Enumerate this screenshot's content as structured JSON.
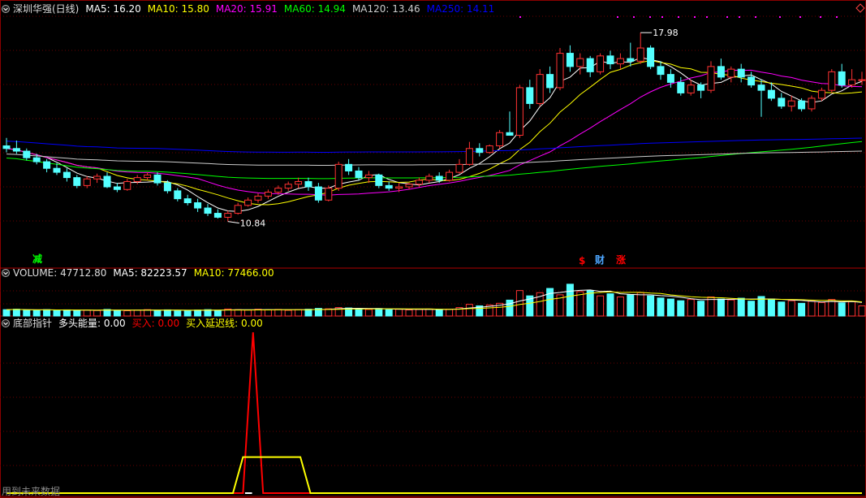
{
  "chart_data": {
    "type": "candlestick",
    "panels": [
      {
        "name": "price",
        "title": "深圳华强(日线)",
        "legend": [
          {
            "label": "MA5: 16.20",
            "color": "#ffffff"
          },
          {
            "label": "MA10: 15.80",
            "color": "#ffff00"
          },
          {
            "label": "MA20: 15.91",
            "color": "#ff00ff"
          },
          {
            "label": "MA60: 14.94",
            "color": "#00ff00"
          },
          {
            "label": "MA120: 13.46",
            "color": "#cccccc"
          },
          {
            "label": "MA250: 14.11",
            "color": "#0000ff"
          }
        ],
        "ylim": [
          10.0,
          18.6
        ],
        "annotations": [
          {
            "text": "17.98",
            "value": 17.98,
            "index": 63
          },
          {
            "text": "10.84",
            "value": 10.84,
            "index": 22
          }
        ],
        "markers": [
          {
            "text": "减",
            "color": "#00ff00"
          },
          {
            "text": "$",
            "color": "#ff0000"
          },
          {
            "text": "财",
            "color": "#4da6ff"
          },
          {
            "text": "涨",
            "color": "#ff0000"
          }
        ],
        "candles": [
          [
            13.7,
            14.0,
            13.45,
            13.6
          ],
          [
            13.6,
            13.9,
            13.4,
            13.5
          ],
          [
            13.5,
            13.6,
            13.15,
            13.25
          ],
          [
            13.25,
            13.4,
            13.0,
            13.1
          ],
          [
            13.1,
            13.2,
            12.7,
            12.85
          ],
          [
            12.85,
            13.05,
            12.6,
            12.7
          ],
          [
            12.7,
            12.85,
            12.35,
            12.5
          ],
          [
            12.5,
            12.6,
            12.1,
            12.2
          ],
          [
            12.2,
            12.55,
            12.1,
            12.45
          ],
          [
            12.45,
            12.65,
            12.3,
            12.55
          ],
          [
            12.55,
            12.7,
            12.1,
            12.15
          ],
          [
            12.15,
            12.3,
            11.95,
            12.05
          ],
          [
            12.05,
            12.45,
            12.0,
            12.35
          ],
          [
            12.35,
            12.6,
            12.25,
            12.5
          ],
          [
            12.5,
            12.7,
            12.4,
            12.6
          ],
          [
            12.6,
            12.7,
            12.2,
            12.3
          ],
          [
            12.3,
            12.4,
            11.9,
            12.0
          ],
          [
            12.0,
            12.1,
            11.6,
            11.7
          ],
          [
            11.7,
            11.85,
            11.45,
            11.55
          ],
          [
            11.55,
            11.7,
            11.2,
            11.35
          ],
          [
            11.35,
            11.5,
            11.05,
            11.15
          ],
          [
            11.15,
            11.3,
            10.95,
            11.0
          ],
          [
            11.0,
            11.25,
            10.84,
            11.15
          ],
          [
            11.15,
            11.55,
            11.1,
            11.45
          ],
          [
            11.45,
            11.75,
            11.4,
            11.65
          ],
          [
            11.65,
            11.9,
            11.55,
            11.8
          ],
          [
            11.8,
            12.05,
            11.7,
            11.95
          ],
          [
            11.95,
            12.2,
            11.85,
            12.1
          ],
          [
            12.1,
            12.35,
            12.0,
            12.25
          ],
          [
            12.25,
            12.5,
            12.1,
            12.35
          ],
          [
            12.35,
            12.5,
            12.0,
            12.15
          ],
          [
            12.15,
            12.3,
            11.55,
            11.65
          ],
          [
            11.65,
            12.2,
            11.6,
            12.1
          ],
          [
            12.1,
            13.1,
            12.0,
            13.0
          ],
          [
            13.0,
            13.2,
            12.6,
            12.75
          ],
          [
            12.75,
            12.9,
            12.4,
            12.5
          ],
          [
            12.5,
            12.75,
            12.3,
            12.6
          ],
          [
            12.6,
            12.65,
            12.1,
            12.2
          ],
          [
            12.2,
            12.35,
            12.0,
            12.1
          ],
          [
            12.1,
            12.3,
            11.95,
            12.15
          ],
          [
            12.15,
            12.3,
            12.05,
            12.25
          ],
          [
            12.25,
            12.5,
            12.15,
            12.4
          ],
          [
            12.4,
            12.65,
            12.3,
            12.55
          ],
          [
            12.55,
            12.7,
            12.3,
            12.4
          ],
          [
            12.4,
            12.8,
            12.35,
            12.7
          ],
          [
            12.7,
            13.2,
            12.65,
            13.0
          ],
          [
            13.0,
            13.85,
            12.95,
            13.6
          ],
          [
            13.6,
            13.8,
            13.3,
            13.45
          ],
          [
            13.45,
            13.75,
            13.4,
            13.7
          ],
          [
            13.7,
            14.3,
            13.6,
            14.2
          ],
          [
            14.2,
            15.0,
            14.1,
            14.1
          ],
          [
            14.1,
            16.0,
            14.0,
            15.9
          ],
          [
            15.9,
            16.2,
            15.1,
            15.3
          ],
          [
            15.3,
            16.6,
            15.2,
            16.4
          ],
          [
            16.4,
            16.7,
            15.7,
            15.9
          ],
          [
            15.9,
            17.4,
            15.8,
            17.2
          ],
          [
            17.2,
            17.5,
            16.5,
            16.7
          ],
          [
            16.7,
            17.2,
            16.4,
            17.0
          ],
          [
            17.0,
            17.1,
            16.3,
            16.5
          ],
          [
            16.5,
            17.2,
            16.4,
            17.1
          ],
          [
            17.1,
            17.3,
            16.6,
            16.8
          ],
          [
            16.8,
            17.2,
            16.6,
            17.0
          ],
          [
            17.0,
            17.6,
            16.7,
            16.9
          ],
          [
            16.9,
            17.98,
            16.8,
            17.4
          ],
          [
            17.4,
            17.5,
            16.6,
            16.7
          ],
          [
            16.7,
            16.9,
            16.2,
            16.4
          ],
          [
            16.4,
            16.6,
            15.9,
            16.1
          ],
          [
            16.1,
            16.3,
            15.6,
            15.7
          ],
          [
            15.7,
            16.2,
            15.6,
            16.0
          ],
          [
            16.0,
            16.1,
            15.5,
            15.8
          ],
          [
            15.8,
            16.9,
            15.7,
            16.7
          ],
          [
            16.7,
            17.0,
            16.2,
            16.3
          ],
          [
            16.3,
            16.7,
            16.1,
            16.6
          ],
          [
            16.6,
            16.8,
            16.1,
            16.3
          ],
          [
            16.3,
            16.5,
            15.9,
            16.0
          ],
          [
            16.0,
            16.2,
            14.8,
            15.8
          ],
          [
            15.8,
            16.1,
            15.4,
            15.5
          ],
          [
            15.5,
            15.7,
            15.1,
            15.2
          ],
          [
            15.2,
            15.6,
            15.0,
            15.4
          ],
          [
            15.4,
            15.5,
            15.0,
            15.1
          ],
          [
            15.1,
            15.6,
            15.0,
            15.5
          ],
          [
            15.5,
            15.9,
            15.4,
            15.8
          ],
          [
            15.8,
            16.6,
            15.7,
            16.5
          ],
          [
            16.5,
            16.8,
            15.9,
            16.0
          ],
          [
            16.0,
            16.6,
            15.9,
            16.2
          ],
          [
            16.2,
            16.5,
            16.0,
            16.2
          ]
        ]
      },
      {
        "name": "volume",
        "title": "VOLUME: 47712.80",
        "legend": [
          {
            "label": "MA5: 82223.57",
            "color": "#ffffff"
          },
          {
            "label": "MA10: 77466.00",
            "color": "#ffff00"
          }
        ],
        "ylim": [
          0,
          180000
        ],
        "volumes": [
          30000,
          32000,
          28000,
          26000,
          30000,
          27000,
          29000,
          25000,
          28000,
          26000,
          31000,
          27000,
          25000,
          28000,
          30000,
          27000,
          29000,
          24000,
          26000,
          28000,
          30000,
          27000,
          33000,
          30000,
          28000,
          32000,
          29000,
          31000,
          27000,
          30000,
          32000,
          36000,
          34000,
          40000,
          38000,
          33000,
          31000,
          35000,
          30000,
          32000,
          29000,
          31000,
          33000,
          30000,
          32000,
          40000,
          55000,
          48000,
          52000,
          60000,
          75000,
          120000,
          95000,
          110000,
          130000,
          100000,
          150000,
          115000,
          120000,
          95000,
          105000,
          90000,
          100000,
          110000,
          95000,
          85000,
          80000,
          72000,
          78000,
          70000,
          90000,
          80000,
          76000,
          84000,
          70000,
          92000,
          80000,
          66000,
          72000,
          60000,
          70000,
          64000,
          78000,
          62000,
          68000,
          48000
        ]
      },
      {
        "name": "indicator",
        "title": "底部指针",
        "legend": [
          {
            "label": "多头能量: 0.00",
            "color": "#ffffff"
          },
          {
            "label": "买入: 0.00",
            "color": "#ff0000"
          },
          {
            "label": "买入延迟线: 0.00",
            "color": "#ffff00"
          }
        ],
        "ylim": [
          0,
          100
        ],
        "series": [
          {
            "name": "买入",
            "color": "#ff0000",
            "points": [
              [
                0,
                0
              ],
              [
                23.5,
                0
              ],
              [
                24.5,
                98
              ],
              [
                25.5,
                0
              ],
              [
                85,
                0
              ]
            ]
          },
          {
            "name": "买入延迟线",
            "color": "#ffff00",
            "points": [
              [
                0,
                0
              ],
              [
                22.5,
                0
              ],
              [
                23.5,
                22
              ],
              [
                29.2,
                22
              ],
              [
                30.2,
                0
              ],
              [
                85,
                0
              ]
            ]
          }
        ],
        "footer": "用到未来数据"
      }
    ]
  }
}
